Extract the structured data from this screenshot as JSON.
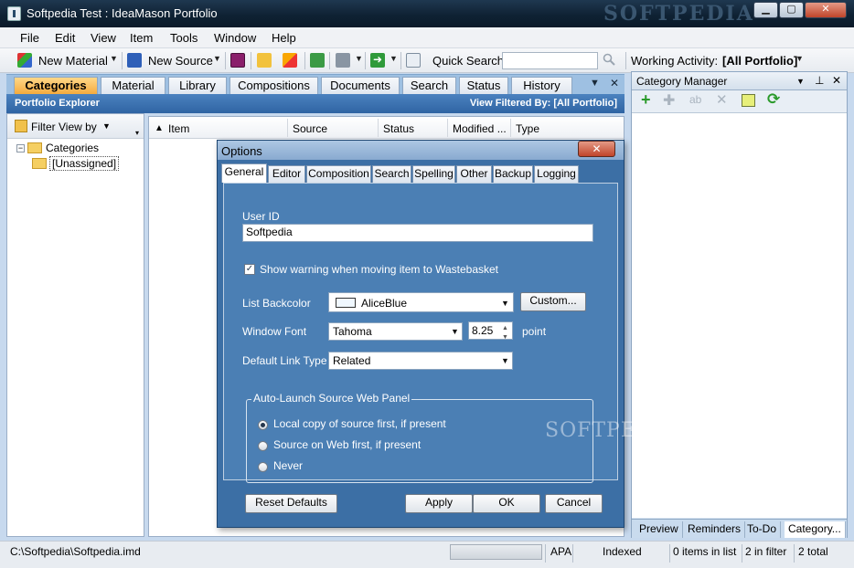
{
  "window": {
    "title": "Softpedia Test : IdeaMason Portfolio",
    "watermark": "SOFTPEDIA",
    "minimize": "▁",
    "maximize": "▢",
    "close": "✕"
  },
  "menu": [
    "File",
    "Edit",
    "View",
    "Item",
    "Tools",
    "Window",
    "Help"
  ],
  "toolbar": {
    "new_material": "New Material",
    "new_source": "New Source",
    "quick_search_label": "Quick Search",
    "quick_search_value": "",
    "working_activity_label": "Working Activity:",
    "working_activity_value": "[All Portfolio]"
  },
  "tabs": [
    "Categories",
    "Material",
    "Library",
    "Compositions",
    "Documents",
    "Search",
    "Status",
    "History"
  ],
  "explorer": {
    "title": "Portfolio Explorer",
    "filter_text": "View Filtered By: [All Portfolio]"
  },
  "left_pane": {
    "filter_label": "Filter View by",
    "tree_root": "Categories",
    "tree_child": "[Unassigned]"
  },
  "list_columns": [
    "Item",
    "Source",
    "Status",
    "Modified ...",
    "Type"
  ],
  "category_manager": {
    "title": "Category Manager",
    "tabs": [
      "Preview",
      "Reminders",
      "To-Do",
      "Category..."
    ]
  },
  "status": {
    "path": "C:\\Softpedia\\Softpedia.imd",
    "style": "APA",
    "indexed": "Indexed",
    "items_in_list": "0 items in list",
    "in_filter": "2 in filter",
    "total": "2 total"
  },
  "options_dialog": {
    "title": "Options",
    "close": "✕",
    "tabs": [
      "General",
      "Editor",
      "Composition",
      "Search",
      "Spelling",
      "Other",
      "Backup",
      "Logging"
    ],
    "user_id_label": "User ID",
    "user_id_value": "Softpedia",
    "warning_checkbox": "Show warning when moving item to Wastebasket",
    "warning_checked": true,
    "list_backcolor_label": "List Backcolor",
    "list_backcolor_value": "AliceBlue",
    "custom_button": "Custom...",
    "window_font_label": "Window Font",
    "window_font_value": "Tahoma",
    "font_size_value": "8.25",
    "font_size_unit": "point",
    "default_link_label": "Default Link Type",
    "default_link_value": "Related",
    "group_title": "Auto-Launch Source Web Panel",
    "radios": [
      "Local copy of source first, if present",
      "Source on Web first, if present",
      "Never"
    ],
    "selected_radio": 0,
    "reset_button": "Reset Defaults",
    "apply_button": "Apply",
    "ok_button": "OK",
    "cancel_button": "Cancel"
  },
  "colors": {
    "accent": "#2f64a3",
    "active_tab": "#f4a83a",
    "dialog_bg": "#4b7fb4",
    "title_bar": "#0f2234"
  }
}
